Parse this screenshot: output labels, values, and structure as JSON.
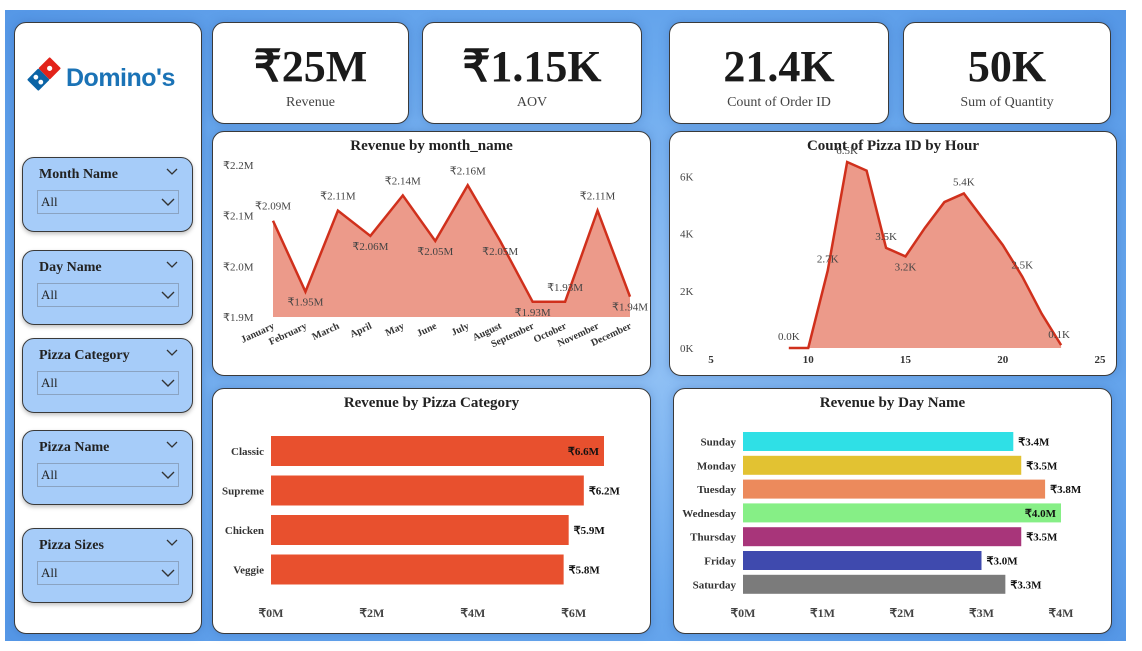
{
  "brand": {
    "name": "Domino's"
  },
  "slicers": [
    {
      "title": "Month Name",
      "value": "All"
    },
    {
      "title": "Day Name",
      "value": "All"
    },
    {
      "title": "Pizza Category",
      "value": "All"
    },
    {
      "title": "Pizza Name",
      "value": "All"
    },
    {
      "title": "Pizza Sizes",
      "value": "All"
    }
  ],
  "kpis": [
    {
      "value": "₹25M",
      "label": "Revenue"
    },
    {
      "value": "₹1.15K",
      "label": "AOV"
    },
    {
      "value": "21.4K",
      "label": "Count of Order ID"
    },
    {
      "value": "50K",
      "label": "Sum of Quantity"
    }
  ],
  "colors": {
    "area_fill": "#ec9a8a",
    "area_line": "#d0301c",
    "category_bar": "#e8502e",
    "day_bars": [
      "#2fe0e6",
      "#e2c232",
      "#ec8a5c",
      "#86ef86",
      "#a8357a",
      "#3f4aae",
      "#7b7b7b"
    ]
  },
  "chart_data": [
    {
      "type": "area",
      "title": "Revenue by month_name",
      "categories": [
        "January",
        "February",
        "March",
        "April",
        "May",
        "June",
        "July",
        "August",
        "September",
        "October",
        "November",
        "December"
      ],
      "values": [
        2.09,
        1.95,
        2.11,
        2.06,
        2.14,
        2.05,
        2.16,
        2.05,
        1.93,
        1.93,
        2.11,
        1.94
      ],
      "data_labels": [
        "₹2.09M",
        "₹1.95M",
        "₹2.11M",
        "₹2.06M",
        "₹2.14M",
        "₹2.05M",
        "₹2.16M",
        "₹2.05M",
        "₹1.93M",
        "₹1.93M",
        "₹2.11M",
        "₹1.94M"
      ],
      "yticks": [
        1.9,
        2.0,
        2.1,
        2.2
      ],
      "ytick_labels": [
        "₹1.9M",
        "₹2.0M",
        "₹2.1M",
        "₹2.2M"
      ],
      "ylim": [
        1.9,
        2.2
      ]
    },
    {
      "type": "area",
      "title": "Count of Pizza ID by Hour",
      "x": [
        9,
        10,
        11,
        12,
        13,
        14,
        15,
        16,
        17,
        18,
        19,
        20,
        21,
        22,
        23
      ],
      "values": [
        0.0,
        0.0,
        2.7,
        6.5,
        6.2,
        3.5,
        3.2,
        4.2,
        5.1,
        5.4,
        4.5,
        3.6,
        2.5,
        1.2,
        0.1
      ],
      "data_labels": [
        {
          "x": 9,
          "text": "0.0K"
        },
        {
          "x": 11,
          "text": "2.7K"
        },
        {
          "x": 12,
          "text": "6.5K"
        },
        {
          "x": 14,
          "text": "3.5K"
        },
        {
          "x": 15,
          "text": "3.2K"
        },
        {
          "x": 18,
          "text": "5.4K"
        },
        {
          "x": 21,
          "text": "2.5K"
        },
        {
          "x": 23,
          "text": "0.1K"
        }
      ],
      "xticks": [
        5,
        10,
        15,
        20,
        25
      ],
      "xlim": [
        5,
        25
      ],
      "yticks": [
        0,
        2,
        4,
        6
      ],
      "ytick_labels": [
        "0K",
        "2K",
        "4K",
        "6K"
      ],
      "ylim": [
        0,
        6.5
      ]
    },
    {
      "type": "bar",
      "orientation": "horizontal",
      "title": "Revenue by Pizza Category",
      "categories": [
        "Classic",
        "Supreme",
        "Chicken",
        "Veggie"
      ],
      "values": [
        6.6,
        6.2,
        5.9,
        5.8
      ],
      "data_labels": [
        "₹6.6M",
        "₹6.2M",
        "₹5.9M",
        "₹5.8M"
      ],
      "xticks": [
        0,
        2,
        4,
        6
      ],
      "xtick_labels": [
        "₹0M",
        "₹2M",
        "₹4M",
        "₹6M"
      ],
      "xlim": [
        0,
        6.6
      ]
    },
    {
      "type": "bar",
      "orientation": "horizontal",
      "title": "Revenue by Day Name",
      "categories": [
        "Sunday",
        "Monday",
        "Tuesday",
        "Wednesday",
        "Thursday",
        "Friday",
        "Saturday"
      ],
      "values": [
        3.4,
        3.5,
        3.8,
        4.0,
        3.5,
        3.0,
        3.3
      ],
      "data_labels": [
        "₹3.4M",
        "₹3.5M",
        "₹3.8M",
        "₹4.0M",
        "₹3.5M",
        "₹3.0M",
        "₹3.3M"
      ],
      "xticks": [
        0,
        1,
        2,
        3,
        4
      ],
      "xtick_labels": [
        "₹0M",
        "₹1M",
        "₹2M",
        "₹3M",
        "₹4M"
      ],
      "xlim": [
        0,
        4.0
      ]
    }
  ]
}
